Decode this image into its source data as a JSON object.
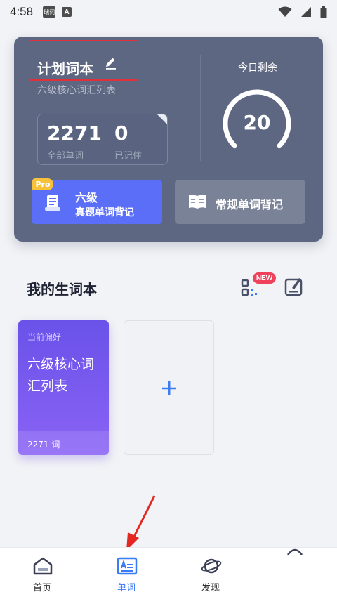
{
  "status_bar": {
    "time": "4:58",
    "app_icon_text": "瑞词",
    "notif_letter": "A"
  },
  "plan_card": {
    "title": "计划词本",
    "subtitle": "六级核心词汇列表",
    "total_words": "2271",
    "total_words_label": "全部单词",
    "memorized": "0",
    "memorized_label": "已记住",
    "today_remaining_label": "今日剩余",
    "today_remaining": "20",
    "today_progress_fraction": 0.0,
    "pro_badge": "Pro",
    "zhenti_line1": "六级",
    "zhenti_line2": "真题单词背记",
    "changgui_label": "常规单词背记",
    "colors": {
      "card_bg": "#5d6781",
      "zhenti_bg": "#5a6ef7",
      "pro_badge": "#f7c13a"
    }
  },
  "notebooks": {
    "section_title": "我的生词本",
    "new_badge": "NEW",
    "items": [
      {
        "tag": "当前偏好",
        "name": "六级核心词汇列表",
        "count": "2271 词"
      }
    ],
    "add_icon": "plus-icon"
  },
  "tabs": [
    {
      "label": "首页",
      "icon": "home-icon",
      "active": false
    },
    {
      "label": "单词",
      "icon": "word-card-icon",
      "active": true
    },
    {
      "label": "发现",
      "icon": "planet-icon",
      "active": false
    }
  ],
  "accent_color": "#3b7bf6"
}
